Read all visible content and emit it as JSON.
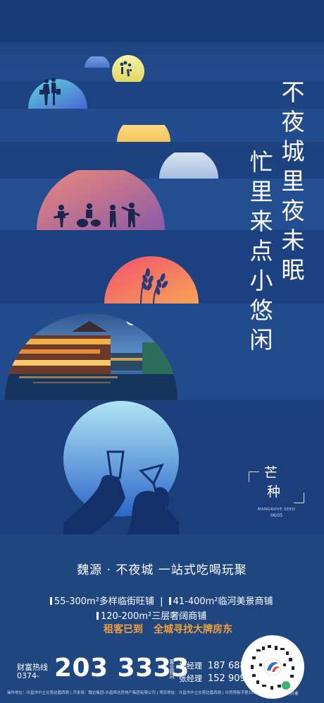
{
  "poster": {
    "background_color": "#1b3f7a",
    "stripe_colors": [
      "#1a3d78",
      "#1f4784",
      "#23508f"
    ],
    "headline_vertical_right": "不夜城里夜未眠",
    "headline_vertical_left": "忙里来点小悠闲",
    "illustrations": [
      {
        "icon": "shopping-couple-silhouette-icon",
        "gradient": [
          "#5fd0e0",
          "#4a6fd1"
        ]
      },
      {
        "icon": "kids-with-balloons-silhouette-icon",
        "gradient": [
          "#f3f29b",
          "#e3d65a"
        ]
      },
      {
        "icon": "rising-sun-half-disc-icon",
        "gradient": [
          "#fde38a",
          "#f4c75a"
        ]
      },
      {
        "icon": "pale-moon-half-disc-icon",
        "gradient": [
          "#d6e3f4",
          "#a9bfdf"
        ]
      },
      {
        "icon": "rock-band-silhouette-icon",
        "gradient": [
          "#f48a7a",
          "#8d5ba6"
        ]
      },
      {
        "icon": "wheat-ears-icon",
        "gradient": [
          "#f25c6b",
          "#f59a56"
        ]
      },
      {
        "icon": "night-riverside-town-photo",
        "gradient": [
          "#1e3a6e",
          "#6aa0d8"
        ]
      },
      {
        "icon": "toasting-glasses-hands-icon",
        "gradient": [
          "#a9e1f5",
          "#2b68c8"
        ]
      }
    ],
    "badge": {
      "line1": "芒",
      "line2": "种",
      "english": "MANGROVE SEED",
      "date": "06/05"
    }
  },
  "bottom": {
    "headline": "魏源 · 不夜城 一站式吃喝玩聚",
    "feature_1": "55-300m²多样临街旺铺",
    "divider": "|",
    "feature_2": "41-400m²临河美景商铺",
    "feature_3": "120-200m²三层奢阔商铺",
    "orange_line_a": "租客已到",
    "orange_line_b": "全城寻找大牌房东",
    "orange_color": "#f2a03a",
    "hotline_label": "财富热线",
    "area_code": "0374-",
    "phone": "203 3333",
    "consultant_label": "置业顾问",
    "contacts": [
      {
        "name": "郑经理",
        "number": "187 6880 6372"
      },
      {
        "name": "张经理",
        "number": "152 9096 5685"
      }
    ],
    "footer": "操作地址：许昌市中立交旁边嘉西侧 | 开发商：魏达集团-许昌恒达房地产集团有限公司 | 项目地址：许昌市中立交旁边嘉西侧 | 许房预售字第2017065号",
    "qr_caption": "扫码有礼 一腾万金"
  }
}
